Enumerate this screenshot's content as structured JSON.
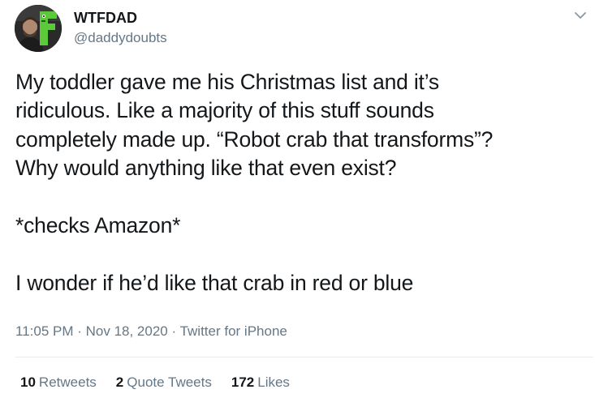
{
  "user": {
    "display_name": "WTFDAD",
    "handle": "@daddydoubts",
    "avatar_logo_letter": "F",
    "avatar_logo_color": "#5cc93a"
  },
  "menu": {
    "icon": "chevron-down-icon"
  },
  "tweet": {
    "text": "My toddler gave me his Christmas list and it’s\nridiculous. Like a majority of this stuff sounds\ncompletely made up. “Robot crab that transforms”?\nWhy would anything like that even exist?\n\n*checks Amazon*\n\nI wonder if he’d like that crab in red or blue"
  },
  "meta": {
    "time": "11:05 PM",
    "sep1": " · ",
    "date": "Nov 18, 2020",
    "sep2": " · ",
    "source": "Twitter for iPhone"
  },
  "stats": {
    "retweets_count": "10",
    "retweets_label": "Retweets",
    "quote_count": "2",
    "quote_label": "Quote Tweets",
    "likes_count": "172",
    "likes_label": "Likes"
  },
  "colors": {
    "text": "#14171a",
    "secondary": "#657786",
    "divider": "#e6ecf0"
  }
}
